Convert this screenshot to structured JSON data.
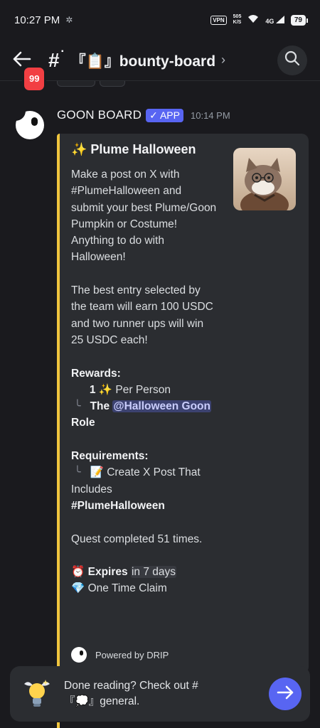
{
  "status_bar": {
    "time": "10:27 PM",
    "vpn": "VPN",
    "speed_value": "505",
    "speed_unit": "K/S",
    "network": "4G",
    "battery": "79"
  },
  "header": {
    "unread_badge": "99",
    "channel_name": "『📋』bounty-board"
  },
  "message": {
    "author": "GOON BOARD",
    "app_tag": "✓ APP",
    "timestamp": "10:14 PM",
    "embed": {
      "accent_color": "#f0c53e",
      "title": "✨ Plume Halloween",
      "para1": "Make a post on X with #PlumeHalloween and submit your best Plume/Goon Pumpkin or Costume! Anything to do with Halloween!",
      "para2": "The best entry selected by the team will earn 100 USDC and two runner ups will win 25 USDC each!",
      "rewards_heading": "Rewards:",
      "reward_count": "1",
      "reward_emoji": "✨",
      "reward_text": "Per Person",
      "reward2_prefix": "The",
      "reward2_mention": "@Halloween Goon",
      "reward2_suffix": "Role",
      "requirements_heading": "Requirements:",
      "requirement_emoji": "📝",
      "requirement_text": "Create X Post That Includes",
      "requirement_hashtag": "#PlumeHalloween",
      "quest_completed": "Quest completed 51 times.",
      "expires_emoji": "⏰",
      "expires_label": "Expires",
      "expires_value": "in 7 days",
      "claim_emoji": "💎",
      "claim_text": "One Time Claim",
      "footer": "Powered by DRIP"
    }
  },
  "bottom_bar": {
    "text": "Done reading? Check out #『💭』general."
  },
  "colors": {
    "background": "#1a1a1e",
    "embed_bg": "#2b2d31",
    "blurple": "#5865f2",
    "badge_red": "#f23f43"
  },
  "icons": [
    "back-arrow-icon",
    "hash-lock-icon",
    "chevron-right-icon",
    "search-icon",
    "arrow-right-icon",
    "lightbulb-icon",
    "gear-icon",
    "wifi-icon"
  ]
}
